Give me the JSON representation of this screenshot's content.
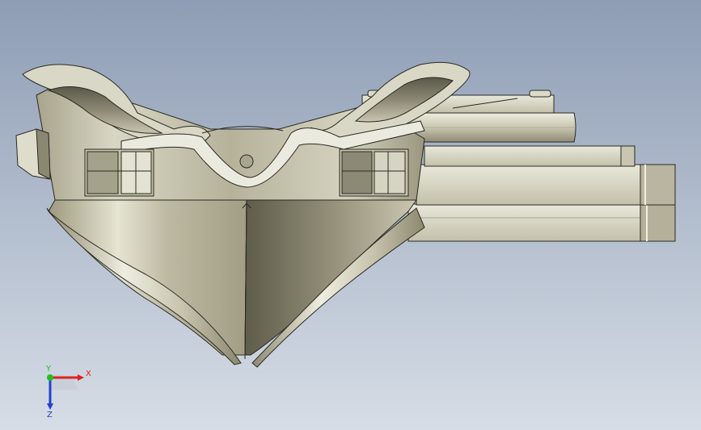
{
  "viewport": {
    "background_top": "#8e9db5",
    "background_bottom": "#d6dde6"
  },
  "triad": {
    "x_label": "X",
    "y_label": "Y",
    "z_label": "Z",
    "x_color": "#e02020",
    "y_color": "#20c020",
    "z_color": "#2040d0"
  }
}
